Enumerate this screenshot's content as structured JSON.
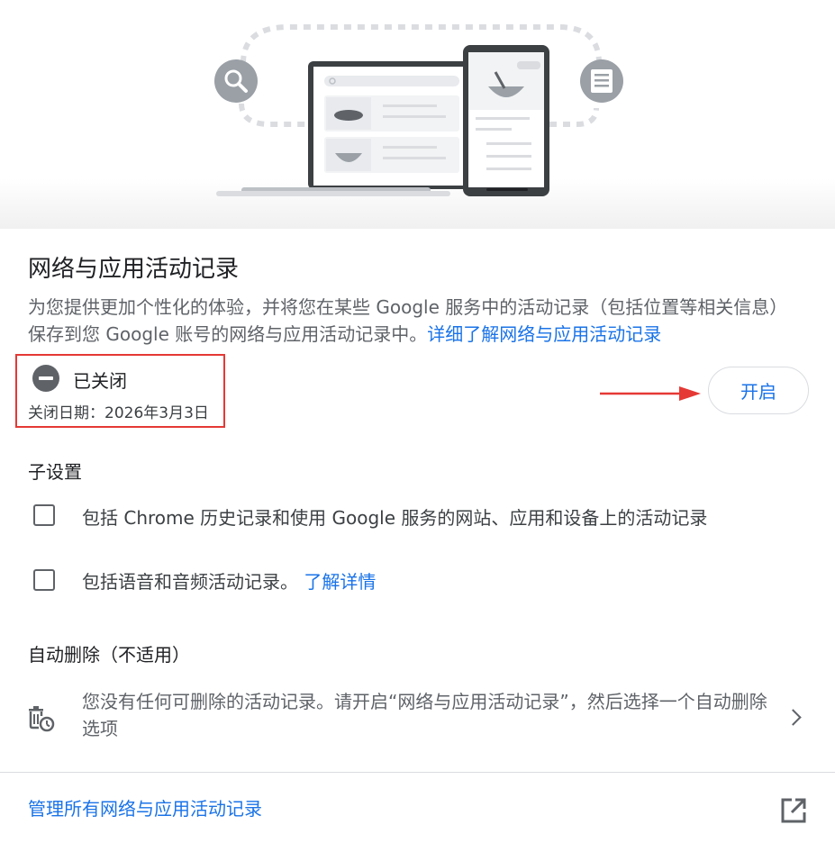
{
  "activity": {
    "title": "网络与应用活动记录",
    "description": "为您提供更加个性化的体验，并将您在某些 Google 服务中的活动记录（包括位置等相关信息）保存到您 Google 账号的网络与应用活动记录中。",
    "learn_more_link": "详细了解网络与应用活动记录",
    "status": {
      "label": "已关闭",
      "date": "关闭日期：2026年3月3日"
    },
    "enable_button": "开启"
  },
  "sub_settings": {
    "title": "子设置",
    "items": [
      {
        "label": "包括 Chrome 历史记录和使用 Google 服务的网站、应用和设备上的活动记录",
        "checked": false
      },
      {
        "label": "包括语音和音频活动记录。",
        "link": "了解详情",
        "checked": false
      }
    ]
  },
  "auto_delete": {
    "title": "自动删除（不适用）",
    "text": "您没有任何可删除的活动记录。请开启“网络与应用活动记录”，然后选择一个自动删除选项",
    "icon": "auto-delete-icon"
  },
  "footer": {
    "manage_link": "管理所有网络与应用活动记录",
    "icon": "open-in-new-icon"
  },
  "colors": {
    "accent": "#1a73e8",
    "highlight_box": "#e53935",
    "arrow": "#e53935",
    "text_secondary": "#5f6368"
  }
}
